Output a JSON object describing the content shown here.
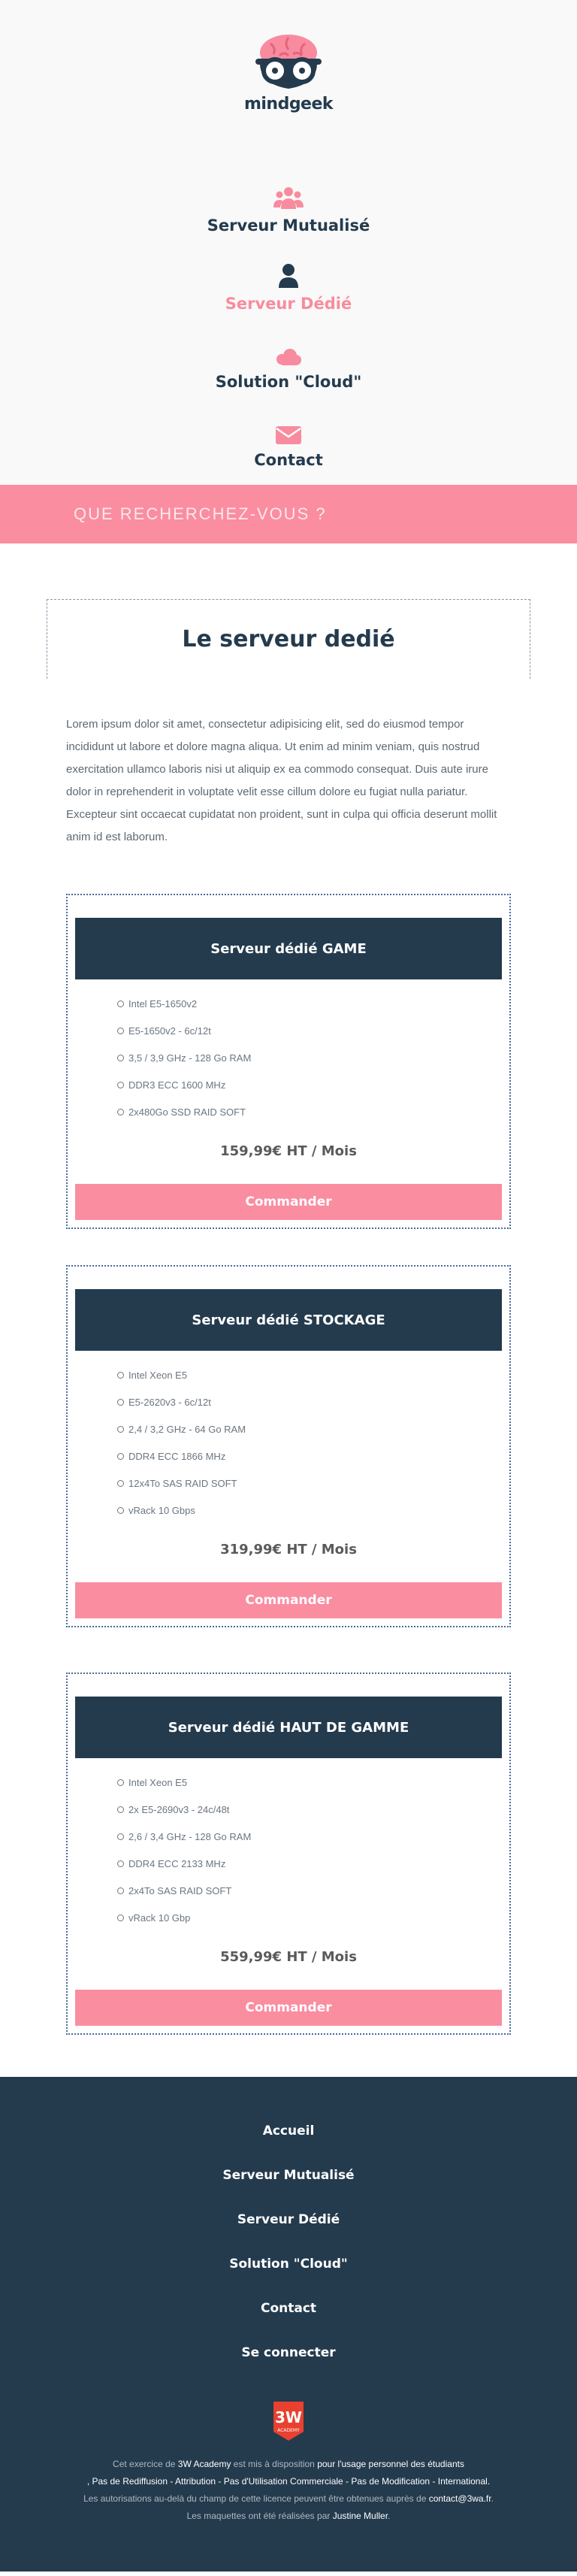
{
  "brand": {
    "name": "mindgeek"
  },
  "menu": {
    "items": [
      {
        "label": "Serveur Mutualisé",
        "icon": "users-icon",
        "active": false
      },
      {
        "label": "Serveur Dédié",
        "icon": "user-icon",
        "active": true
      },
      {
        "label": "Solution \"Cloud\"",
        "icon": "cloud-icon",
        "active": false
      },
      {
        "label": "Contact",
        "icon": "envelope-icon",
        "active": false
      }
    ]
  },
  "search": {
    "label": "QUE RECHERCHEZ-VOUS ?"
  },
  "main": {
    "title": "Le serveur dedié",
    "intro": "Lorem ipsum dolor sit amet, consectetur adipisicing elit, sed do eiusmod tempor incididunt ut labore et dolore magna aliqua. Ut enim ad minim veniam, quis nostrud exercitation ullamco laboris nisi ut aliquip ex ea commodo consequat. Duis aute irure dolor in reprehenderit in voluptate velit esse cillum dolore eu fugiat nulla pariatur. Excepteur sint occaecat cupidatat non proident, sunt in culpa qui officia deserunt mollit anim id est laborum."
  },
  "offers": [
    {
      "title": "Serveur dédié GAME",
      "specs": [
        "Intel E5-1650v2",
        "E5-1650v2 - 6c/12t",
        "3,5 / 3,9 GHz - 128 Go RAM",
        "DDR3 ECC 1600 MHz",
        "2x480Go SSD RAID SOFT"
      ],
      "price": "159,99€ HT / Mois",
      "button": "Commander"
    },
    {
      "title": "Serveur dédié STOCKAGE",
      "specs": [
        "Intel Xeon E5",
        "E5-2620v3 - 6c/12t",
        "2,4 / 3,2 GHz - 64 Go RAM",
        "DDR4 ECC 1866 MHz",
        "12x4To SAS RAID SOFT",
        "vRack 10 Gbps"
      ],
      "price": "319,99€ HT / Mois",
      "button": "Commander"
    },
    {
      "title": "Serveur dédié HAUT DE GAMME",
      "specs": [
        "Intel Xeon E5",
        "2x E5-2690v3 - 24c/48t",
        "2,6 / 3,4 GHz - 128 Go RAM",
        "DDR4 ECC 2133 MHz",
        "2x4To SAS RAID SOFT",
        "vRack 10 Gbp"
      ],
      "price": "559,99€ HT / Mois",
      "button": "Commander"
    }
  ],
  "footer": {
    "nav": [
      "Accueil",
      "Serveur Mutualisé",
      "Serveur Dédié",
      "Solution \"Cloud\"",
      "Contact",
      "Se connecter"
    ],
    "badge": {
      "line1": "3W",
      "line2": "ACADEMY"
    },
    "legal": {
      "p1_a": "Cet exercice de ",
      "p1_b": "3W Academy",
      "p1_c": " est mis à disposition ",
      "p1_d": "pour l'usage personnel des étudiants",
      "p1_e": ", Pas de Rediffusion - Attribution - Pas d'Utilisation Commerciale - Pas de Modification - International.",
      "p2_a": "Les autorisations au-delà du champ de cette licence peuvent être obtenues auprès de ",
      "p2_b": "contact@3wa.fr",
      "p2_c": ".",
      "p3_a": "Les maquettes ont été réalisées par ",
      "p3_b": "Justine Muller",
      "p3_c": "."
    }
  },
  "colors": {
    "navy": "#243b4e",
    "pink": "#fa8da0",
    "background": "#f9f9f9"
  }
}
